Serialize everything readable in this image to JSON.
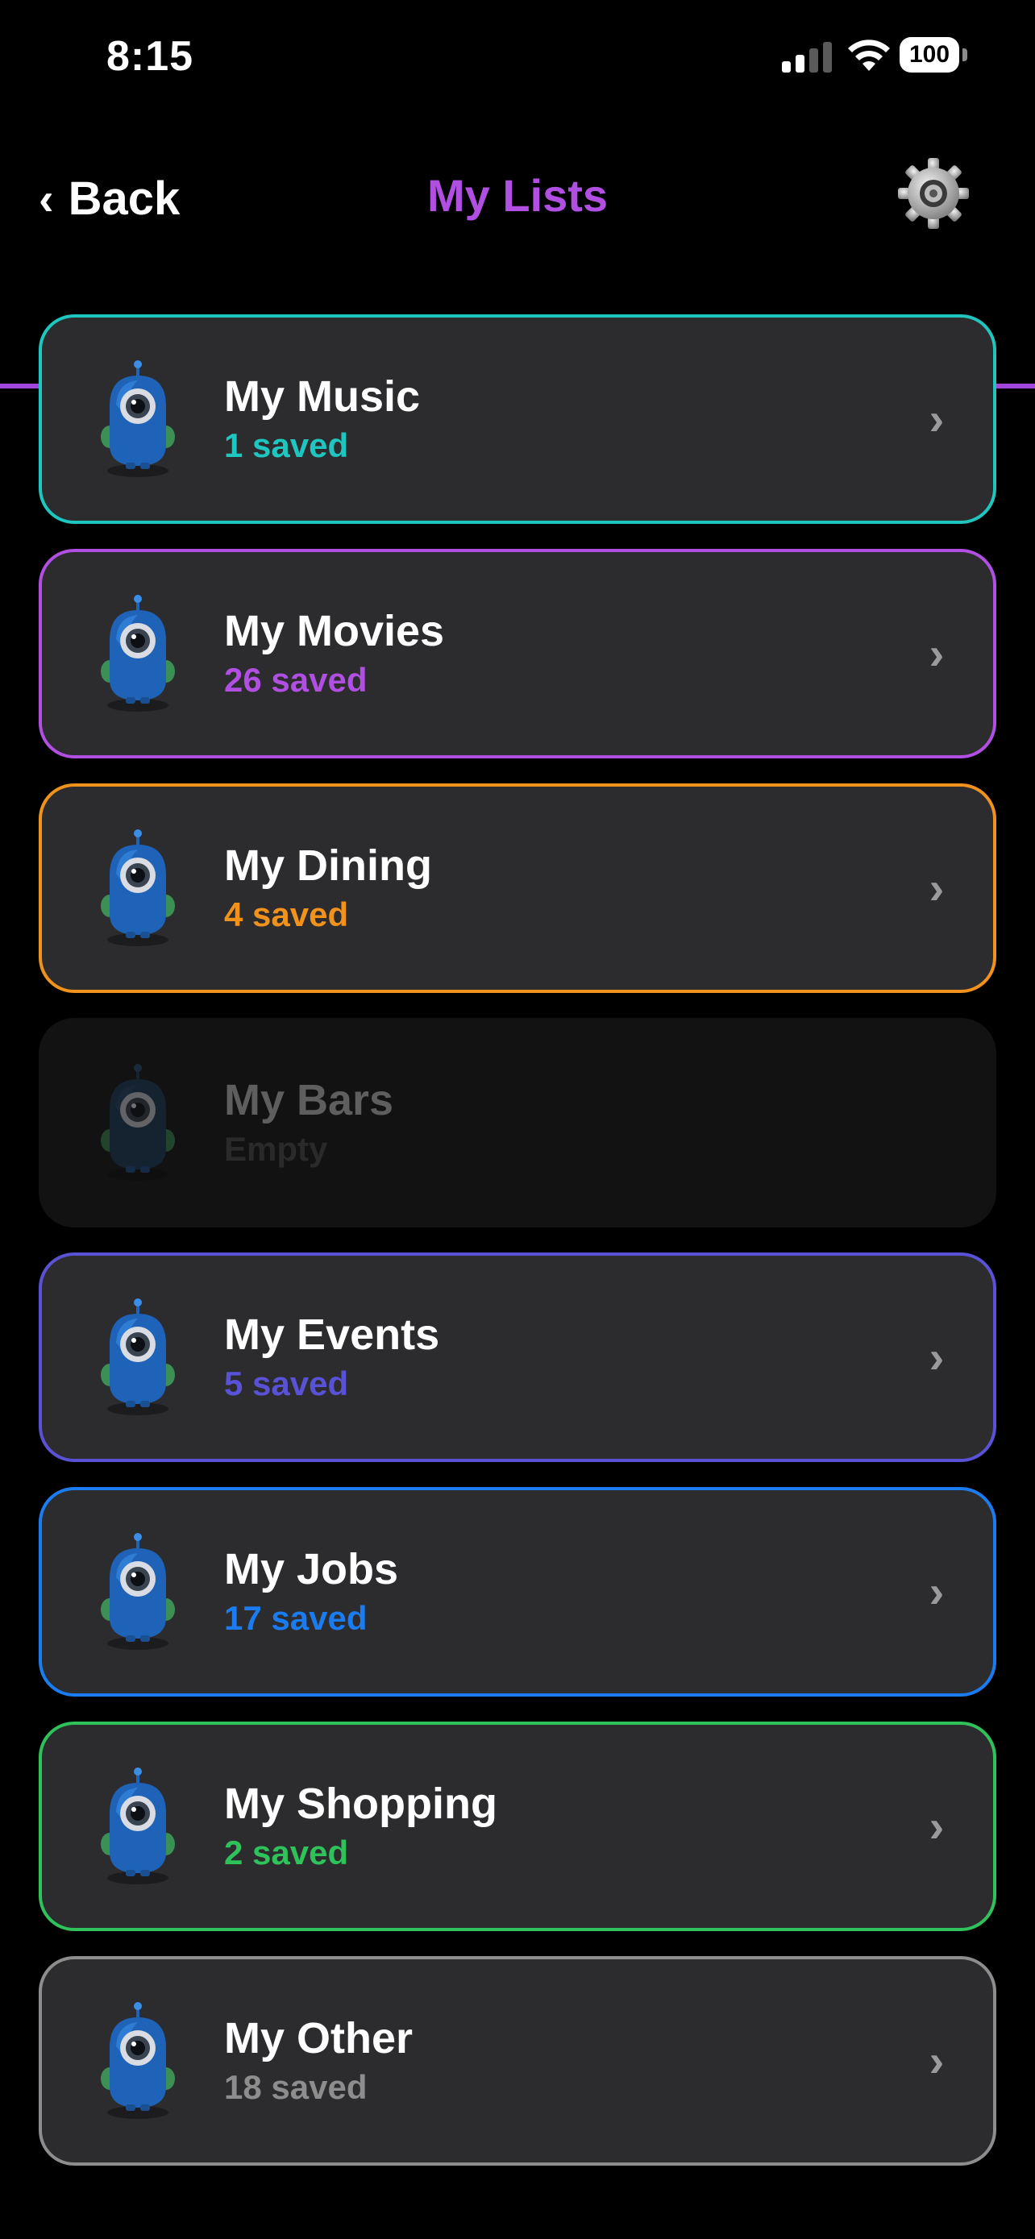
{
  "status": {
    "time": "8:15",
    "battery": "100"
  },
  "nav": {
    "back_label": "Back",
    "back_chevron": "‹",
    "title": "My Lists",
    "settings_icon": "gear-icon"
  },
  "colors": {
    "accent": "#a347dc",
    "title": "#b04fe2",
    "card_bg": "#2c2c2e",
    "background": "#000000"
  },
  "lists": [
    {
      "title": "My Music",
      "count": "1 saved",
      "color": "#1fc6bf",
      "enabled": true,
      "avatar": "robot-headphones-icon"
    },
    {
      "title": "My Movies",
      "count": "26 saved",
      "color": "#b04fe2",
      "enabled": true,
      "avatar": "robot-clapperboard-icon"
    },
    {
      "title": "My Dining",
      "count": "4 saved",
      "color": "#f0921c",
      "enabled": true,
      "avatar": "robot-chef-icon"
    },
    {
      "title": "My Bars",
      "count": "Empty",
      "color": "#2a2a2a",
      "enabled": false,
      "avatar": "robot-cocktail-icon"
    },
    {
      "title": "My Events",
      "count": "5 saved",
      "color": "#5a52d6",
      "enabled": true,
      "avatar": "robot-ticket-icon"
    },
    {
      "title": "My Jobs",
      "count": "17 saved",
      "color": "#1a7cf0",
      "enabled": true,
      "avatar": "robot-briefcase-icon"
    },
    {
      "title": "My Shopping",
      "count": "2 saved",
      "color": "#2fc25a",
      "enabled": true,
      "avatar": "robot-shopping-bag-icon"
    },
    {
      "title": "My Other",
      "count": "18 saved",
      "color": "#8d8d8d",
      "enabled": true,
      "avatar": "robot-question-icon"
    }
  ]
}
